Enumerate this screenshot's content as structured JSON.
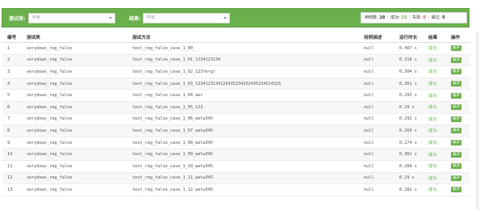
{
  "filters": {
    "test_class_label": "测试类:",
    "test_class_value": "所有",
    "result_label": "结果:",
    "result_value": "所有"
  },
  "stats": {
    "total_label": "用例数:",
    "total": "28",
    "passed_label": "成功:",
    "passed": "13",
    "failed_label": "失败:",
    "failed": "0",
    "skipped_label": "跳过:",
    "skipped": "0"
  },
  "colors": {
    "accent": "#6ab04c",
    "fail": "#d9534f"
  },
  "table": {
    "headers": {
      "index": "编号",
      "test_class": "测试类",
      "test_method": "测试方法",
      "description": "用例描述",
      "duration": "运行时长",
      "result": "结果",
      "action": "操作"
    },
    "rows": [
      {
        "index": "1",
        "test_class": "verydows_reg_false",
        "test_method": "test_reg_false_case_1_00_",
        "description": "null",
        "duration": "0.407 s",
        "result": "成功",
        "action": "展开"
      },
      {
        "index": "2",
        "test_class": "verydows_reg_false",
        "test_method": "test_reg_false_case_1_01_1234123134",
        "description": "null",
        "duration": "0.318 s",
        "result": "成功",
        "action": "展开"
      },
      {
        "index": "3",
        "test_class": "verydows_reg_false",
        "test_method": "test_reg_false_case_1_02_123fergr",
        "description": "null",
        "duration": "0.304 s",
        "result": "成功",
        "action": "展开"
      },
      {
        "index": "4",
        "test_class": "verydows_reg_false",
        "test_method": "test_reg_false_case_1_03_1234123134125435234252435234514325",
        "description": "null",
        "duration": "0.361 s",
        "result": "成功",
        "action": "展开"
      },
      {
        "index": "5",
        "test_class": "verydows_reg_false",
        "test_method": "test_reg_false_case_1_04_wer",
        "description": "null",
        "duration": "0.293 s",
        "result": "成功",
        "action": "展开"
      },
      {
        "index": "6",
        "test_class": "verydows_reg_false",
        "test_method": "test_reg_false_case_1_05_123",
        "description": "null",
        "duration": "0.29 s",
        "result": "成功",
        "action": "展开"
      },
      {
        "index": "7",
        "test_class": "verydows_reg_false",
        "test_method": "test_reg_false_case_1_06_wetw345",
        "description": "null",
        "duration": "0.292 s",
        "result": "成功",
        "action": "展开"
      },
      {
        "index": "8",
        "test_class": "verydows_reg_false",
        "test_method": "test_reg_false_case_1_07_wetw345",
        "description": "null",
        "duration": "0.269 s",
        "result": "成功",
        "action": "展开"
      },
      {
        "index": "9",
        "test_class": "verydows_reg_false",
        "test_method": "test_reg_false_case_1_08_wetw345",
        "description": "null",
        "duration": "0.274 s",
        "result": "成功",
        "action": "展开"
      },
      {
        "index": "10",
        "test_class": "verydows_reg_false",
        "test_method": "test_reg_false_case_1_09_wetw345",
        "description": "null",
        "duration": "0.302 s",
        "result": "成功",
        "action": "展开"
      },
      {
        "index": "11",
        "test_class": "verydows_reg_false",
        "test_method": "test_reg_false_case_1_10_wetw345",
        "description": "null",
        "duration": "0.284 s",
        "result": "成功",
        "action": "展开"
      },
      {
        "index": "12",
        "test_class": "verydows_reg_false",
        "test_method": "test_reg_false_case_1_11_wetw345",
        "description": "null",
        "duration": "0.29 s",
        "result": "成功",
        "action": "展开"
      },
      {
        "index": "13",
        "test_class": "verydows_reg_false",
        "test_method": "test_reg_false_case_1_12_wetw345",
        "description": "null",
        "duration": "0.282 s",
        "result": "成功",
        "action": "展开"
      }
    ]
  }
}
